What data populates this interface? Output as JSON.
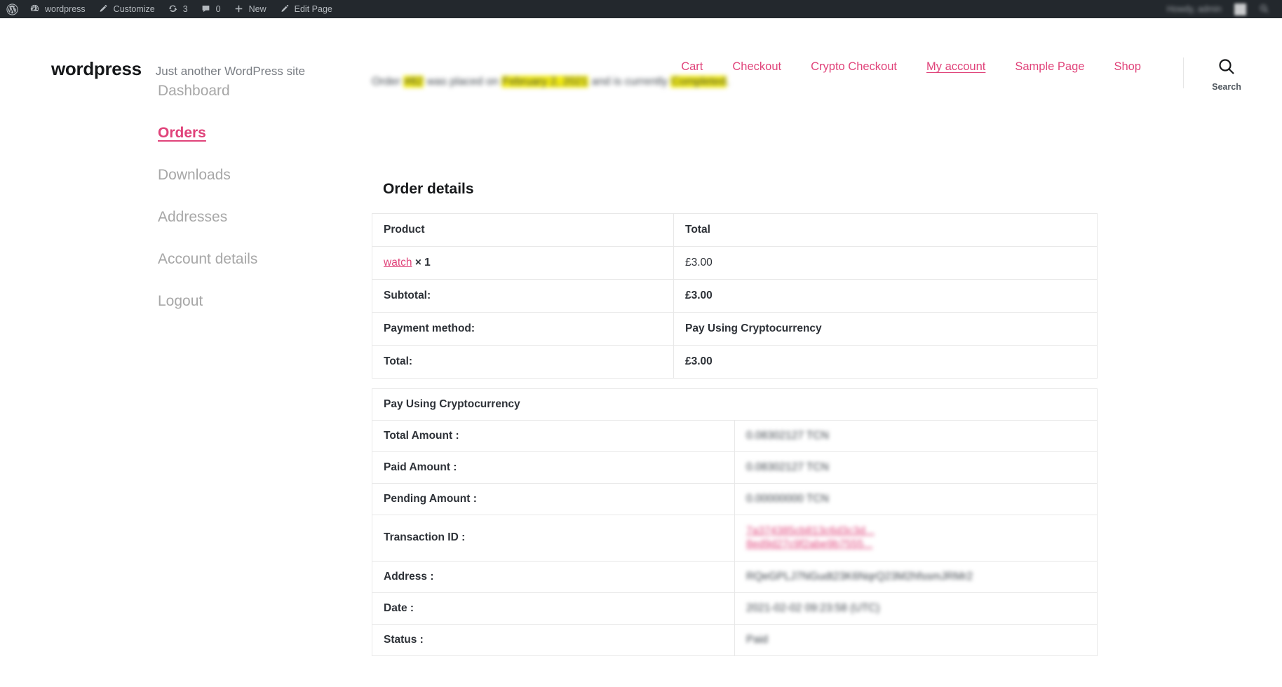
{
  "adminbar": {
    "logo_icon": "wordpress-logo-icon",
    "items": [
      {
        "icon": "dashboard-icon",
        "label": "wordpress"
      },
      {
        "icon": "brush-icon",
        "label": "Customize"
      },
      {
        "icon": "update-icon",
        "label": "3"
      },
      {
        "icon": "comment-icon",
        "label": "0"
      },
      {
        "icon": "plus-icon",
        "label": "New"
      },
      {
        "icon": "pencil-icon",
        "label": "Edit Page"
      }
    ],
    "right": {
      "howdy": "Howdy, admin",
      "avatar": "avatar",
      "search_icon": "search-icon"
    }
  },
  "header": {
    "site_title": "wordpress",
    "tagline": "Just another WordPress site",
    "nav": [
      {
        "label": "Cart",
        "current": false
      },
      {
        "label": "Checkout",
        "current": false
      },
      {
        "label": "Crypto Checkout",
        "current": false
      },
      {
        "label": "My account",
        "current": true
      },
      {
        "label": "Sample Page",
        "current": false
      },
      {
        "label": "Shop",
        "current": false
      }
    ],
    "search": {
      "icon": "search-icon",
      "label": "Search"
    }
  },
  "account_nav": {
    "items": [
      {
        "label": "Dashboard",
        "active": false
      },
      {
        "label": "Orders",
        "active": true
      },
      {
        "label": "Downloads",
        "active": false
      },
      {
        "label": "Addresses",
        "active": false
      },
      {
        "label": "Account details",
        "active": false
      },
      {
        "label": "Logout",
        "active": false
      }
    ]
  },
  "order": {
    "status_line": {
      "prefix": "Order ",
      "number": "#82",
      "middle": " was placed on ",
      "date": "February 2, 2021",
      "suffix": " and is currently ",
      "status": "Completed",
      "end": "."
    },
    "details_title": "Order details",
    "table": {
      "headers": [
        "Product",
        "Total"
      ],
      "rows": [
        {
          "type": "product",
          "name": "watch",
          "qty": "× 1",
          "total": "£3.00"
        },
        {
          "type": "summary",
          "label": "Subtotal:",
          "value": "£3.00"
        },
        {
          "type": "summary",
          "label": "Payment method:",
          "value": "Pay Using Cryptocurrency"
        },
        {
          "type": "summary",
          "label": "Total:",
          "value": "£3.00"
        }
      ]
    },
    "crypto": {
      "title": "Pay Using Cryptocurrency",
      "rows": [
        {
          "label": "Total Amount :",
          "value": "0.08302127 TCN",
          "kind": "text"
        },
        {
          "label": "Paid Amount :",
          "value": "0.08302127 TCN",
          "kind": "text"
        },
        {
          "label": "Pending Amount :",
          "value": "0.00000000 TCN",
          "kind": "text"
        },
        {
          "label": "Transaction ID :",
          "value": "7a374385cb813c6d3c3d...\n8ed9d27c9f2abe9b7555...",
          "kind": "link"
        },
        {
          "label": "Address :",
          "value": "RQeGPLJ7NGudt23K6NqrQ23M2hfssmJRMr2",
          "kind": "text"
        },
        {
          "label": "Date :",
          "value": "2021-02-02 09:23:58 (UTC)",
          "kind": "text"
        },
        {
          "label": "Status :",
          "value": "Paid",
          "kind": "text"
        }
      ]
    }
  },
  "colors": {
    "accent": "#e0437a",
    "adminbar_bg": "#23282d",
    "highlight": "#f3ec12",
    "text": "#2d3137"
  }
}
